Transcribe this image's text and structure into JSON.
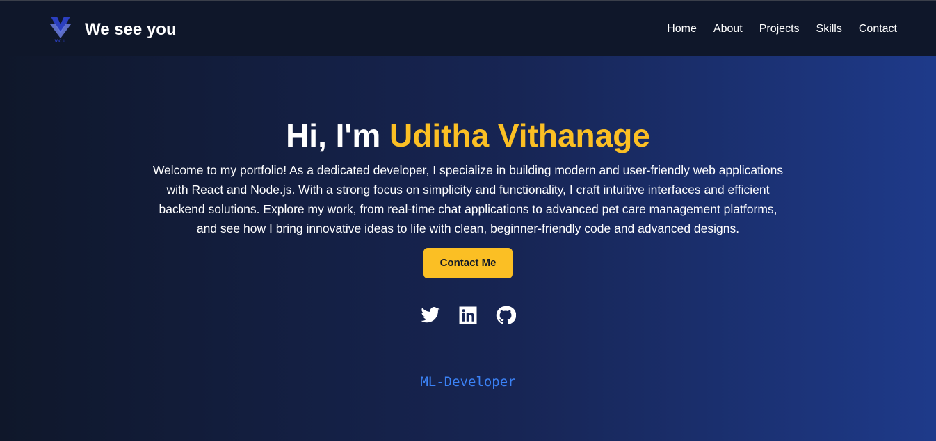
{
  "brand": {
    "logo_text": "VCU",
    "name": "We see you"
  },
  "nav": {
    "items": [
      {
        "label": "Home"
      },
      {
        "label": "About"
      },
      {
        "label": "Projects"
      },
      {
        "label": "Skills"
      },
      {
        "label": "Contact"
      }
    ]
  },
  "hero": {
    "greeting": "Hi, I'm ",
    "name": "Uditha Vithanage",
    "description": "Welcome to my portfolio! As a dedicated developer, I specialize in building modern and user-friendly web applications with React and Node.js. With a strong focus on simplicity and functionality, I craft intuitive interfaces and efficient backend solutions. Explore my work, from real-time chat applications to advanced pet care management platforms, and see how I bring innovative ideas to life with clean, beginner-friendly code and advanced designs.",
    "cta_label": "Contact Me",
    "role": "ML-Developer"
  },
  "socials": [
    {
      "icon": "twitter-icon"
    },
    {
      "icon": "linkedin-icon"
    },
    {
      "icon": "github-icon"
    }
  ],
  "colors": {
    "accent": "#fbbf24",
    "nav_bg": "#0f172a",
    "role_text": "#3b82f6",
    "logo": "#2b3fbf"
  }
}
